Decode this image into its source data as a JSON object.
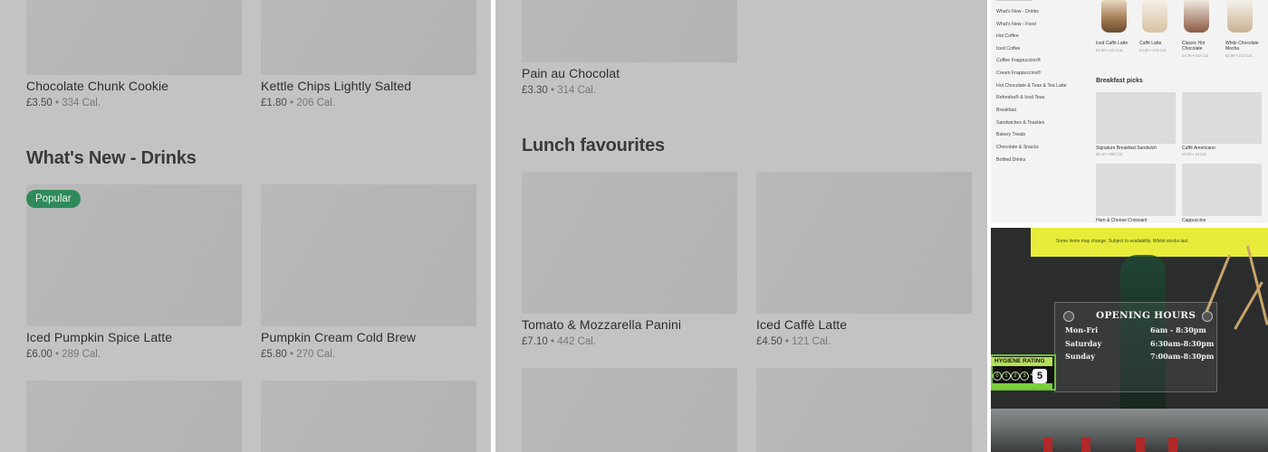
{
  "left_panel": {
    "row1": [
      {
        "name": "Chocolate Chunk Cookie",
        "price": "£3.50",
        "sep": " • ",
        "cal": "334 Cal."
      },
      {
        "name": "Kettle Chips Lightly Salted",
        "price": "£1.80",
        "sep": " • ",
        "cal": "206 Cal."
      }
    ],
    "section_title": "What's New - Drinks",
    "badge": "Popular",
    "row2": [
      {
        "name": "Iced Pumpkin Spice Latte",
        "price": "£6.00",
        "sep": " • ",
        "cal": "289 Cal."
      },
      {
        "name": "Pumpkin Cream Cold Brew",
        "price": "£5.80",
        "sep": " • ",
        "cal": "270 Cal."
      }
    ]
  },
  "middle_panel": {
    "row1": [
      {
        "name": "Pain au Chocolat",
        "price": "£3.30",
        "sep": " • ",
        "cal": "314 Cal."
      }
    ],
    "section_title": "Lunch favourites",
    "row2": [
      {
        "name": "Tomato & Mozzarella Panini",
        "price": "£7.10",
        "sep": " • ",
        "cal": "442 Cal."
      },
      {
        "name": "Iced Caffè Latte",
        "price": "£4.50",
        "sep": " • ",
        "cal": "121 Cal."
      }
    ]
  },
  "screenshot_panel": {
    "sidebar": [
      "What's New - Drinks",
      "What's New - Food",
      "Hot Coffee",
      "Iced Coffee",
      "Coffee Frappuccino®",
      "Cream Frappuccino®",
      "Hot Chocolate & Teas & Tea Latte",
      "Refresha® & Iced Teas",
      "Breakfast",
      "Sandwiches & Toasties",
      "Bakery Treats",
      "Chocolate & Snacks",
      "Bottled Drinks"
    ],
    "drinks": [
      {
        "name": "Iced Caffè Latte",
        "meta": "£4.50 • 121 Cal."
      },
      {
        "name": "Caffè Latte",
        "meta": "£4.50 • 174 Cal."
      },
      {
        "name": "Classic Hot Chocolate",
        "meta": "£4.75 • 322 Cal."
      },
      {
        "name": "White Chocolate Mocha",
        "meta": "£5.90 • 314 Cal."
      }
    ],
    "section_title": "Breakfast picks",
    "breakfast": [
      {
        "name": "Signature Breakfast Sandwich",
        "meta": "£6.10 • 383 Cal."
      },
      {
        "name": "Caffè Americano",
        "meta": "£4.00 • 16 Cal."
      },
      {
        "name": "Ham & Cheese Croissant",
        "meta": ""
      },
      {
        "name": "Cappuccino",
        "meta": ""
      }
    ]
  },
  "photo_panel": {
    "notice": "Some items may change. Subject to availability. Whilst stocks last.",
    "title": "OPENING HOURS",
    "hours": [
      {
        "day": "Mon-Fri",
        "time": "6am - 8:30pm"
      },
      {
        "day": "Saturday",
        "time": "6:30am-8:30pm"
      },
      {
        "day": "Sunday",
        "time": "7:00am-8:30pm"
      }
    ],
    "hygiene_label": "HYGIENE RATING",
    "hygiene_circles": [
      "0",
      "1",
      "2",
      "3",
      "4"
    ],
    "hygiene_score": "5"
  }
}
